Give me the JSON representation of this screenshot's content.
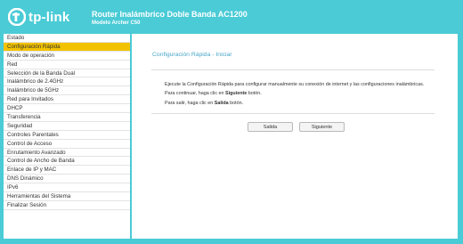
{
  "header": {
    "logo_text": "tp-link",
    "title": "Router Inalámbrico Doble Banda AC1200",
    "model": "Modelo Archer C50"
  },
  "sidebar": {
    "items": [
      {
        "label": "Estado"
      },
      {
        "label": "Configuración Rápida"
      },
      {
        "label": "Modo de operación"
      },
      {
        "label": "Red"
      },
      {
        "label": "Selección de la Banda Dual"
      },
      {
        "label": "Inalámbrico de 2.4GHz"
      },
      {
        "label": "Inalámbrico de 5GHz"
      },
      {
        "label": "Red para Invitados"
      },
      {
        "label": "DHCP"
      },
      {
        "label": "Transferencia"
      },
      {
        "label": "Seguridad"
      },
      {
        "label": "Controles Parentales"
      },
      {
        "label": "Control de Acceso"
      },
      {
        "label": "Enrutamiento Avanzado"
      },
      {
        "label": "Control de Ancho de Banda"
      },
      {
        "label": "Enlace de IP y MAC"
      },
      {
        "label": "DNS Dinámico"
      },
      {
        "label": "IPv6"
      },
      {
        "label": "Herramientas del Sistema"
      },
      {
        "label": "Finalizar Sesión"
      }
    ],
    "active_index": 1
  },
  "main": {
    "panel_title": "Configuración Rápida - Iniciar",
    "line1": "Ejecute la Configuración Rápida para configurar manualmente su conexión de internet y las configuraciones inalámbricas.",
    "line2_prefix": "Para continuar, haga clic en",
    "line2_strong": "Siguiente",
    "line2_suffix": "botón.",
    "line3_prefix": "Para salir, haga clic en",
    "line3_strong": "Salida",
    "line3_suffix": "botón.",
    "exit_label": "Salida",
    "next_label": "Siguiente"
  },
  "colors": {
    "accent": "#4acbd6",
    "active_menu": "#f2c200",
    "title_blue": "#4aa7c8"
  }
}
